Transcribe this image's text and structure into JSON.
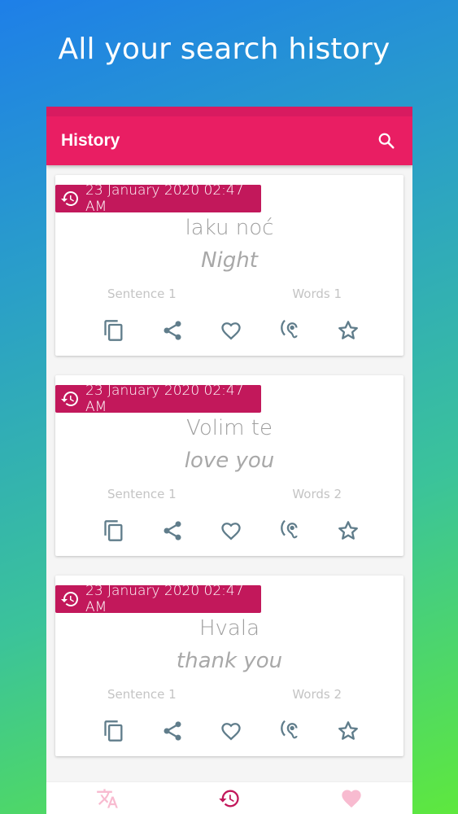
{
  "promo": {
    "title": "All your search history"
  },
  "app_bar": {
    "title": "History"
  },
  "cards": [
    {
      "date": "23 January 2020 02:47 AM",
      "word": "laku noć",
      "translation": "Night",
      "sentence": "Sentence  1",
      "words": "Words 1"
    },
    {
      "date": "23 January 2020 02:47 AM",
      "word": "Volim te",
      "translation": "love you",
      "sentence": "Sentence  1",
      "words": "Words 2"
    },
    {
      "date": "23 January 2020 02:47 AM",
      "word": "Hvala",
      "translation": "thank you",
      "sentence": "Sentence  1",
      "words": "Words 2"
    }
  ],
  "icons": {
    "search": "search-icon",
    "history": "history-icon",
    "copy": "copy-icon",
    "share": "share-icon",
    "favorite": "heart-icon",
    "speak": "hearing-icon",
    "star": "star-icon",
    "translate": "translate-icon"
  },
  "colors": {
    "primary": "#e91e63",
    "primary_dark": "#c2185b",
    "icon": "#607d8b",
    "nav_active": "#c2185b",
    "nav_inactive": "#f8bbd0"
  }
}
